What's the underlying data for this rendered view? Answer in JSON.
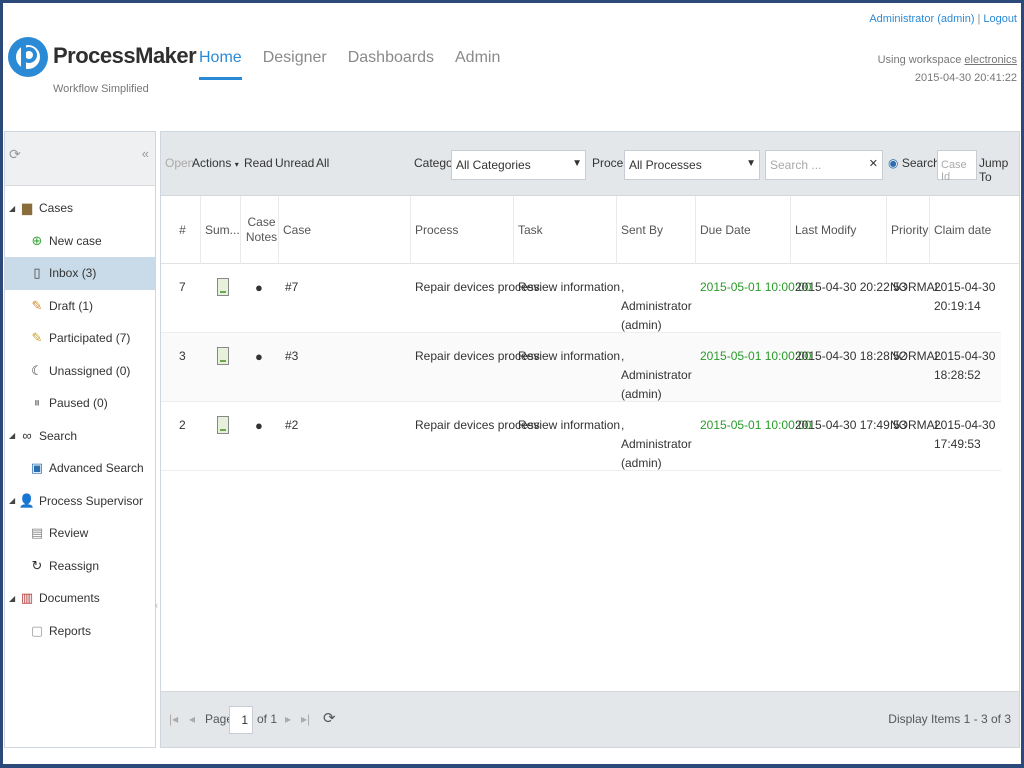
{
  "header": {
    "logo_title": "ProcessMaker",
    "logo_subtitle": "Workflow Simplified",
    "nav": [
      "Home",
      "Designer",
      "Dashboards",
      "Admin"
    ],
    "user": "Administrator (admin)",
    "logout": "Logout",
    "workspace_prefix": "Using workspace",
    "workspace": "electronics",
    "datetime": "2015-04-30 20:41:22"
  },
  "sidebar": {
    "items": [
      {
        "label": "Cases",
        "level": 0,
        "icon": "folder-icon"
      },
      {
        "label": "New case",
        "level": 1,
        "icon": "new-case-icon"
      },
      {
        "label": "Inbox (3)",
        "level": 1,
        "icon": "inbox-icon",
        "selected": true
      },
      {
        "label": "Draft (1)",
        "level": 1,
        "icon": "draft-icon"
      },
      {
        "label": "Participated (7)",
        "level": 1,
        "icon": "participated-icon"
      },
      {
        "label": "Unassigned (0)",
        "level": 1,
        "icon": "unassigned-icon"
      },
      {
        "label": "Paused (0)",
        "level": 1,
        "icon": "paused-icon"
      },
      {
        "label": "Search",
        "level": 0,
        "icon": "binoculars-icon"
      },
      {
        "label": "Advanced Search",
        "level": 1,
        "icon": "advanced-search-icon"
      },
      {
        "label": "Process Supervisor",
        "level": 0,
        "icon": "supervisor-icon"
      },
      {
        "label": "Review",
        "level": 1,
        "icon": "review-icon"
      },
      {
        "label": "Reassign",
        "level": 1,
        "icon": "reassign-icon"
      },
      {
        "label": "Documents",
        "level": 0,
        "icon": "documents-icon"
      },
      {
        "label": "Reports",
        "level": 1,
        "icon": "reports-icon"
      }
    ]
  },
  "toolbar": {
    "open": "Open",
    "actions": "Actions",
    "read": "Read",
    "unread": "Unread",
    "all": "All",
    "category_label": "Category",
    "category_value": "All Categories",
    "process_label": "Process",
    "process_value": "All Processes",
    "search_placeholder": "Search ...",
    "search_button": "Search",
    "caseid_placeholder": "Case Id",
    "jump_to": "Jump To"
  },
  "table": {
    "columns": [
      "#",
      "Sum...",
      "Case Notes",
      "Case",
      "Process",
      "Task",
      "Sent By",
      "Due Date",
      "Last Modify",
      "Priority",
      "Claim date"
    ],
    "rows": [
      {
        "num": "7",
        "case": "#7",
        "process": "Repair devices process",
        "task": "Review information",
        "sent_by": ", Administrator (admin)",
        "due": "2015-05-01 10:00:00",
        "modify": "2015-04-30 20:22:53",
        "priority": "NORMAL",
        "claim": "2015-04-30 20:19:14"
      },
      {
        "num": "3",
        "case": "#3",
        "process": "Repair devices process",
        "task": "Review information",
        "sent_by": ", Administrator (admin)",
        "due": "2015-05-01 10:00:00",
        "modify": "2015-04-30 18:28:52",
        "priority": "NORMAL",
        "claim": "2015-04-30 18:28:52"
      },
      {
        "num": "2",
        "case": "#2",
        "process": "Repair devices process",
        "task": "Review information",
        "sent_by": ", Administrator (admin)",
        "due": "2015-05-01 10:00:00",
        "modify": "2015-04-30 17:49:53",
        "priority": "NORMAL",
        "claim": "2015-04-30 17:49:53"
      }
    ]
  },
  "pager": {
    "page_label": "Page",
    "page_value": "1",
    "of_label": "of 1",
    "display": "Display Items 1 - 3 of 3"
  },
  "colors": {
    "accent": "#2b8ad6",
    "due": "#2a9a2a",
    "frame": "#2b4a7a"
  }
}
